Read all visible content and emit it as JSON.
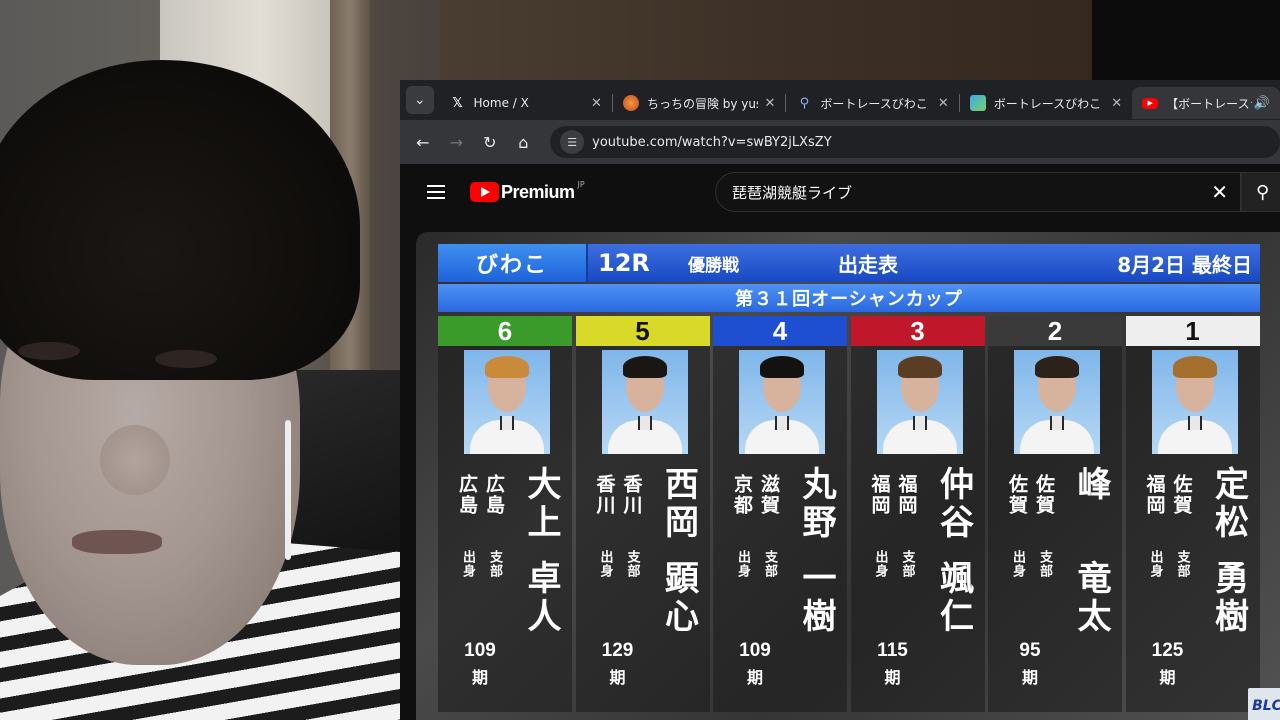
{
  "browser": {
    "tabs": [
      {
        "title": "Home / X",
        "favicon": "x-logo-icon",
        "active": false
      },
      {
        "title": "ちっちの冒険 by yusuke",
        "favicon": "avatar-icon",
        "active": false
      },
      {
        "title": "ボートレースびわこ - 検索",
        "favicon": "search-icon",
        "active": false
      },
      {
        "title": "ボートレースびわこ Official",
        "favicon": "site-icon",
        "active": false
      },
      {
        "title": "【ボートレースライブ】",
        "favicon": "youtube-icon",
        "active": true
      }
    ],
    "url": "youtube.com/watch?v=swBY2jLXsZY"
  },
  "youtube": {
    "brand": "Premium",
    "region": "JP",
    "search_query": "琵琶湖競艇ライブ"
  },
  "board": {
    "venue": "びわこ",
    "race_number": "12R",
    "race_type": "優勝戦",
    "board_title": "出走表",
    "date": "8月2日 最終日",
    "event_title": "第３１回オーシャンカップ",
    "watermark": "BLC",
    "branch_label": "支部",
    "birthplace_label": "出身",
    "term_suffix": "期",
    "racers": [
      {
        "lane": "6",
        "lane_color": "#3a9b2a",
        "lane_text_color": "#ffffff",
        "name_family": "大上",
        "name_given": "卓人",
        "branch": "広島",
        "birthplace": "広島",
        "term": "109",
        "hair_color": "#c98a3a"
      },
      {
        "lane": "5",
        "lane_color": "#d9d92a",
        "lane_text_color": "#111111",
        "name_family": "西岡",
        "name_given": "顕心",
        "branch": "香川",
        "birthplace": "香川",
        "term": "129",
        "hair_color": "#1a1614"
      },
      {
        "lane": "4",
        "lane_color": "#1d4fd0",
        "lane_text_color": "#ffffff",
        "name_family": "丸野",
        "name_given": "一樹",
        "branch": "滋賀",
        "birthplace": "京都",
        "term": "109",
        "hair_color": "#141210"
      },
      {
        "lane": "3",
        "lane_color": "#c0182a",
        "lane_text_color": "#ffffff",
        "name_family": "仲谷",
        "name_given": "颯仁",
        "branch": "福岡",
        "birthplace": "福岡",
        "term": "115",
        "hair_color": "#5a3d22"
      },
      {
        "lane": "2",
        "lane_color": "#3a3a3a",
        "lane_text_color": "#ffffff",
        "name_family": "峰",
        "name_given": "竜太",
        "branch": "佐賀",
        "birthplace": "佐賀",
        "term": "95",
        "hair_color": "#2b221b"
      },
      {
        "lane": "1",
        "lane_color": "#eeeeee",
        "lane_text_color": "#111111",
        "name_family": "定松",
        "name_given": "勇樹",
        "branch": "佐賀",
        "birthplace": "福岡",
        "term": "125",
        "hair_color": "#a5702e"
      }
    ]
  }
}
